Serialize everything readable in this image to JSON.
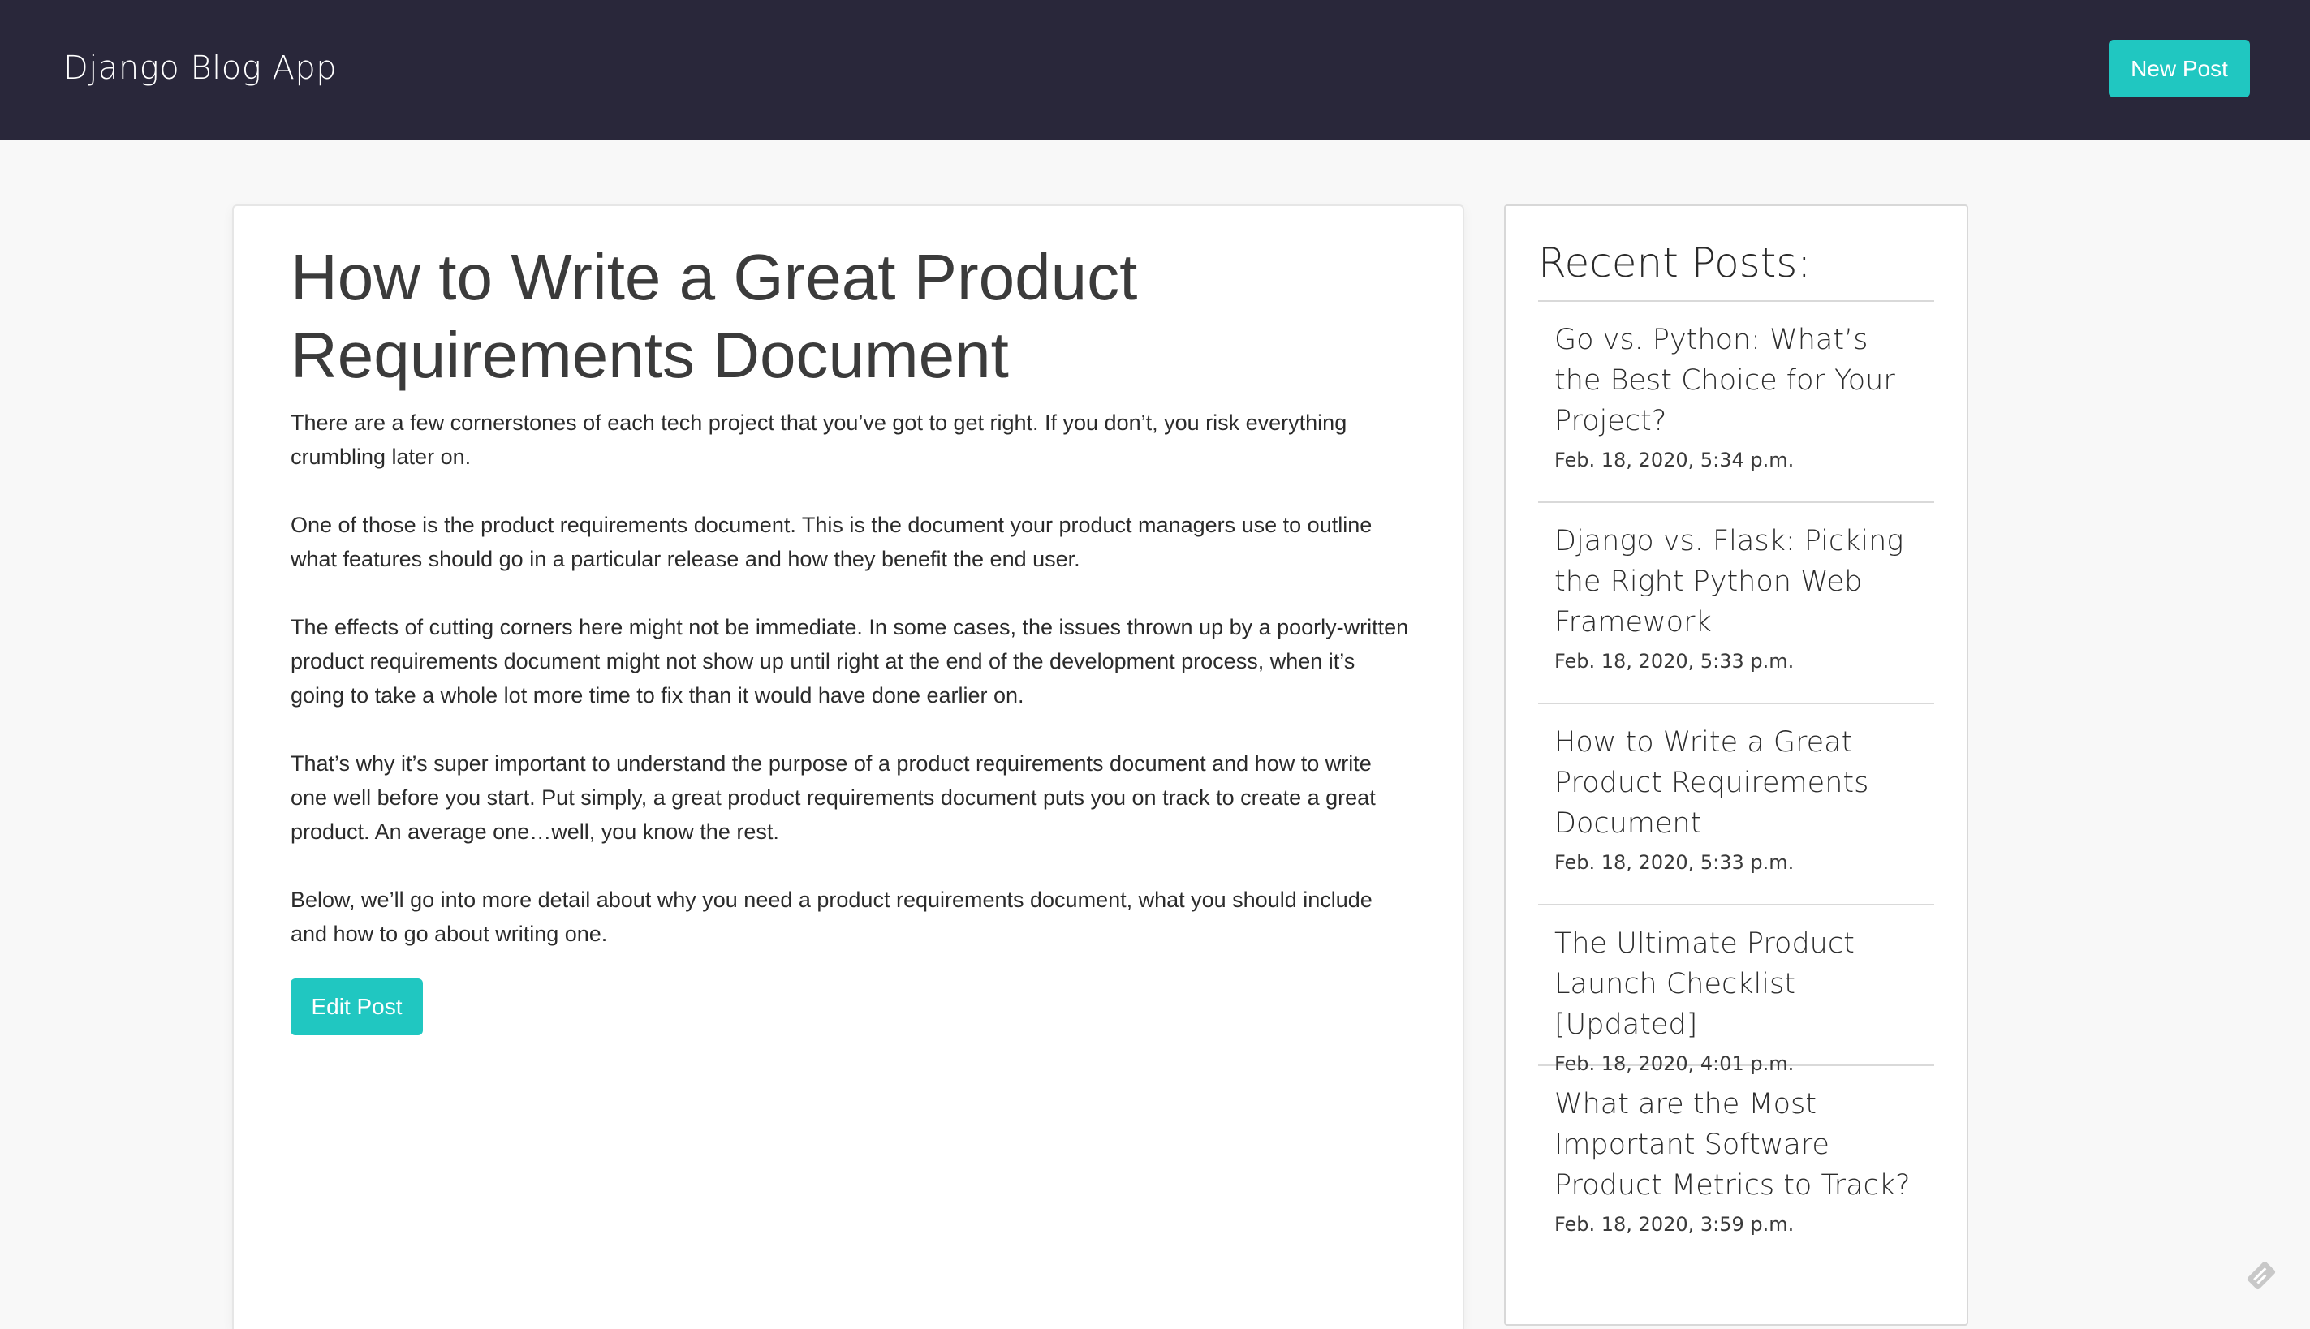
{
  "navbar": {
    "brand": "Django Blog App",
    "new_post_label": "New Post"
  },
  "post": {
    "title": "How to Write a Great Product Requirements Document",
    "paragraphs": [
      "There are a few cornerstones of each tech project that you’ve got to get right. If you don’t, you risk everything crumbling later on.",
      "One of those is the product requirements document. This is the document your product managers use to outline what features should go in a particular release and how they benefit the end user.",
      "The effects of cutting corners here might not be immediate. In some cases, the issues thrown up by a poorly-written product requirements document might not show up until right at the end of the development process, when it’s going to take a whole lot more time to fix than it would have done earlier on.",
      "That’s why it’s super important to understand the purpose of a product requirements document and how to write one well before you start. Put simply, a great product requirements document puts you on track to create a great product. An average one…well, you know the rest.",
      "Below, we’ll go into more detail about why you need a product requirements document, what you should include and how to go about writing one."
    ],
    "edit_label": "Edit Post"
  },
  "sidebar": {
    "title": "Recent Posts:",
    "items": [
      {
        "title": "Go vs. Python: What’s the Best Choice for Your Project?",
        "date": "Feb. 18, 2020, 5:34 p.m."
      },
      {
        "title": "Django vs. Flask: Picking the Right Python Web Framework",
        "date": "Feb. 18, 2020, 5:33 p.m."
      },
      {
        "title": "How to Write a Great Product Requirements Document",
        "date": "Feb. 18, 2020, 5:33 p.m."
      },
      {
        "title": "The Ultimate Product Launch Checklist [Updated]",
        "date": "Feb. 18, 2020, 4:01 p.m."
      },
      {
        "title": "What are the Most Important Software Product Metrics to Track?",
        "date": "Feb. 18, 2020, 3:59 p.m."
      }
    ]
  },
  "colors": {
    "navbar_bg": "#29273a",
    "accent": "#20c7c1",
    "page_bg": "#f8f8f8"
  },
  "icons": {
    "corner": "feedback-icon"
  }
}
